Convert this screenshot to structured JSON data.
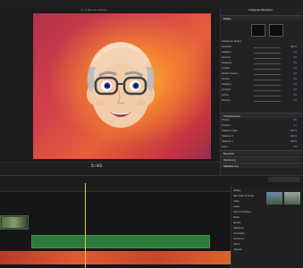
{
  "viewer": {
    "clip_title": "A7_6 Bas wie Abhören",
    "timecode": "5:03"
  },
  "inspector": {
    "header_title": "Intelligenter Bild-Modus",
    "section_titles": [
      "Effekte",
      "Transformieren",
      "Beschnitt",
      "Verzerrung",
      "Stabilisierung"
    ],
    "rows": [
      {
        "label": "Intelligenter Modus",
        "value": ""
      },
      {
        "label": "Deckkraft",
        "value": "100 %"
      },
      {
        "label": "Helligkeit",
        "value": "0.0"
      },
      {
        "label": "Kontrast",
        "value": "0.0"
      },
      {
        "label": "Sättigung",
        "value": "0.0"
      },
      {
        "label": "Schärfe",
        "value": "0.0"
      },
      {
        "label": "Weiche Kanten",
        "value": "0.0"
      },
      {
        "label": "Farbton",
        "value": "0.0"
      },
      {
        "label": "Hauttöne",
        "value": "0.0"
      },
      {
        "label": "Schatten",
        "value": "0.0"
      },
      {
        "label": "Lichter",
        "value": "0.0"
      },
      {
        "label": "Mischen",
        "value": "1.0"
      }
    ],
    "transform_rows": [
      {
        "label": "Position",
        "value": "0  0"
      },
      {
        "label": "Rotation",
        "value": "0 °"
      },
      {
        "label": "Skalieren (alle)",
        "value": "100 %"
      },
      {
        "label": "Skalieren X",
        "value": "100 %"
      },
      {
        "label": "Skalieren Y",
        "value": "100 %"
      },
      {
        "label": "Anker",
        "value": "0  0"
      }
    ]
  },
  "browser": {
    "items": [
      "Effekte",
      "Alle Video & Audio",
      "Video",
      "Audio",
      "Licht & Schatten",
      "Matte",
      "Modus",
      "Stilisieren",
      "Unschärfe",
      "Verzerren",
      "Farbe",
      "Vignette"
    ]
  }
}
